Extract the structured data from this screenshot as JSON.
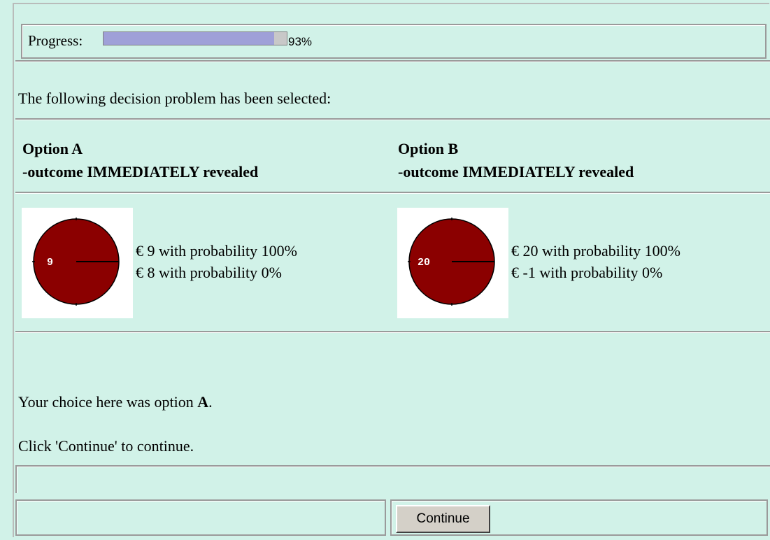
{
  "progress": {
    "label": "Progress:",
    "percent": 93,
    "value_text": "93%"
  },
  "intro": "The following decision problem has been selected:",
  "options": [
    {
      "title": "Option A",
      "subtitle": "-outcome IMMEDIATELY revealed",
      "pie_label": "9",
      "pie_color": "#8b0000",
      "outcomes": [
        "€ 9 with probability 100%",
        "€ 8 with probability 0%"
      ]
    },
    {
      "title": "Option B",
      "subtitle": "-outcome IMMEDIATELY revealed",
      "pie_label": "20",
      "pie_color": "#8b0000",
      "outcomes": [
        "€ 20 with probability 100%",
        "€ -1 with probability 0%"
      ]
    }
  ],
  "choice": {
    "prefix": "Your choice here was option ",
    "value": "A",
    "suffix": "."
  },
  "instruction": "Click 'Continue' to continue.",
  "continue_label": "Continue"
}
